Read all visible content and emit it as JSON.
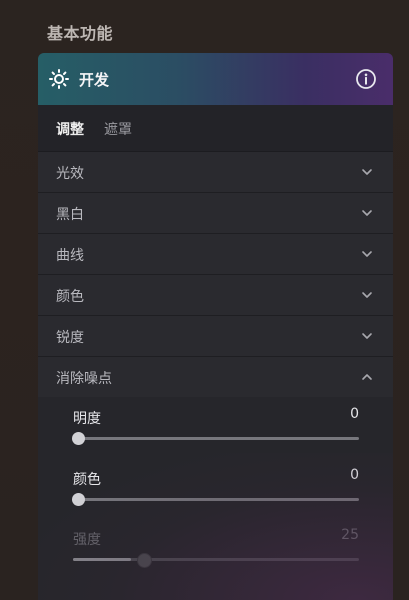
{
  "section_title": "基本功能",
  "panel": {
    "title": "开发",
    "icon": "sun-icon",
    "info_icon": "info-icon",
    "header_colors": [
      "#265e66",
      "#3a2f62",
      "#4a2d6a"
    ]
  },
  "tabs": [
    {
      "label": "调整",
      "active": true
    },
    {
      "label": "遮罩",
      "active": false
    }
  ],
  "accordion": [
    {
      "label": "光效",
      "open": false
    },
    {
      "label": "黑白",
      "open": false
    },
    {
      "label": "曲线",
      "open": false
    },
    {
      "label": "颜色",
      "open": false
    },
    {
      "label": "锐度",
      "open": false
    },
    {
      "label": "消除噪点",
      "open": true
    }
  ],
  "denoise": {
    "sliders": [
      {
        "label": "明度",
        "value": "0",
        "level": 0.0,
        "enabled": true
      },
      {
        "label": "颜色",
        "value": "0",
        "level": 0.0,
        "enabled": true
      },
      {
        "label": "强度",
        "value": "25",
        "level": 0.25,
        "enabled": false
      }
    ]
  }
}
